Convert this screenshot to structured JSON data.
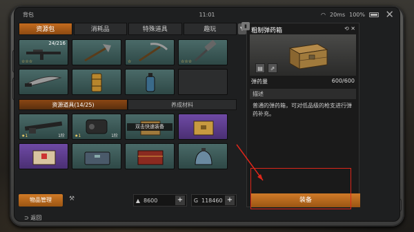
{
  "status": {
    "app_name": "背包",
    "time": "11:01",
    "ping": "20ms",
    "battery": "100%"
  },
  "tabs": [
    {
      "label": "资源包",
      "active": true
    },
    {
      "label": "消耗品",
      "active": false
    },
    {
      "label": "特殊道具",
      "active": false
    },
    {
      "label": "趣玩",
      "active": false
    }
  ],
  "top_slots": [
    {
      "rarity": "teal",
      "icon": "rifle-icon",
      "count": "24/216",
      "stars": "☆☆☆"
    },
    {
      "rarity": "teal",
      "icon": "axe-icon",
      "count": "",
      "stars": ""
    },
    {
      "rarity": "teal",
      "icon": "pickaxe-icon",
      "count": "",
      "stars": "☆"
    },
    {
      "rarity": "teal",
      "icon": "hammer-icon",
      "count": "",
      "stars": "☆☆☆"
    },
    {
      "rarity": "teal",
      "icon": "machete-icon",
      "count": "",
      "stars": ""
    },
    {
      "rarity": "teal",
      "icon": "barrel-icon",
      "count": "",
      "stars": ""
    },
    {
      "rarity": "teal",
      "icon": "bottle-icon",
      "count": "",
      "stars": ""
    },
    {
      "rarity": "empty",
      "icon": "",
      "count": "",
      "stars": ""
    }
  ],
  "subtabs": [
    {
      "label": "资源道具(14/25)",
      "active": true
    },
    {
      "label": "养成材料",
      "active": false
    }
  ],
  "mid_slots": [
    {
      "rarity": "teal",
      "icon": "gun-part-icon",
      "stars": "★1",
      "lv": "1阶"
    },
    {
      "rarity": "teal",
      "icon": "engine-part-icon",
      "stars": "★1",
      "lv": "1阶"
    },
    {
      "rarity": "teal",
      "icon": "ammo-crate-icon",
      "stars": "",
      "lv": "",
      "tooltip": "双击快速装备"
    },
    {
      "rarity": "purple",
      "icon": "gold-crate-icon",
      "stars": "",
      "lv": ""
    },
    {
      "rarity": "purple",
      "icon": "medkit-box-icon",
      "stars": "",
      "lv": ""
    },
    {
      "rarity": "teal",
      "icon": "metal-case-icon",
      "stars": "",
      "lv": ""
    },
    {
      "rarity": "teal",
      "icon": "red-chest-icon",
      "stars": "",
      "lv": ""
    },
    {
      "rarity": "teal",
      "icon": "bag-icon",
      "stars": "",
      "lv": ""
    }
  ],
  "bottom": {
    "manage_label": "物品管理",
    "currency1": "8600",
    "currency2": "118460",
    "back_label": "返回"
  },
  "detail": {
    "title": "粗制弹药箱",
    "stat_label": "弹药量",
    "stat_value": "600/600",
    "desc_head": "描述",
    "desc_text": "普通的弹药箱，可对低品级的枪支进行弹药补充。",
    "equip_label": "装备"
  }
}
